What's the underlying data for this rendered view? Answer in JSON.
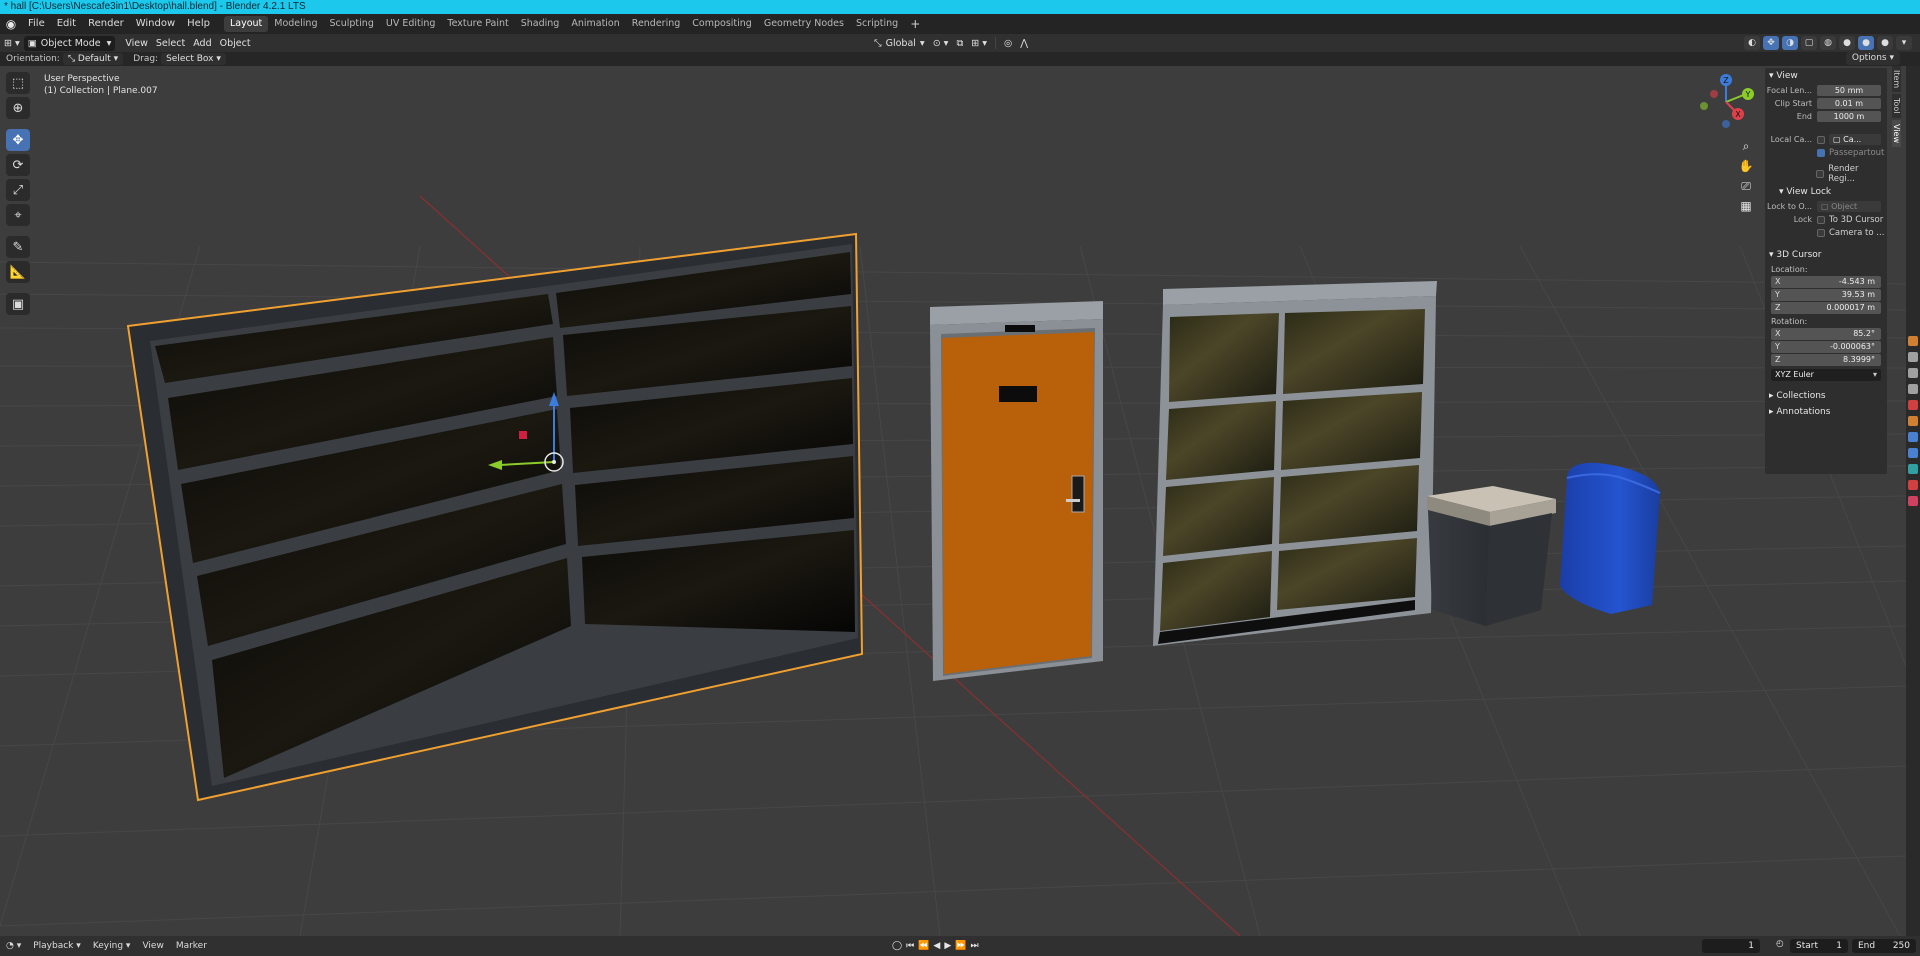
{
  "window": {
    "title": "* hall [C:\\Users\\Nescafe3in1\\Desktop\\hall.blend] - Blender 4.2.1 LTS"
  },
  "menubar": {
    "menus": [
      "File",
      "Edit",
      "Render",
      "Window",
      "Help"
    ],
    "workspaces": [
      "Layout",
      "Modeling",
      "Sculpting",
      "UV Editing",
      "Texture Paint",
      "Shading",
      "Animation",
      "Rendering",
      "Compositing",
      "Geometry Nodes",
      "Scripting"
    ],
    "active_workspace": "Layout",
    "add_label": "+"
  },
  "header": {
    "mode": "Object Mode",
    "menus": [
      "View",
      "Select",
      "Add",
      "Object"
    ],
    "transform_orientation": "Global"
  },
  "subheader": {
    "orientation_label": "Orientation:",
    "orientation_value": "Default",
    "drag_label": "Drag:",
    "drag_value": "Select Box",
    "options_label": "Options"
  },
  "viewport": {
    "view_name": "User Perspective",
    "collection_info": "(1) Collection | Plane.007"
  },
  "npanel": {
    "view_section": "View",
    "focal_label": "Focal Len...",
    "focal_value": "50 mm",
    "clip_start_label": "Clip Start",
    "clip_start_value": "0.01 m",
    "clip_end_label": "End",
    "clip_end_value": "1000 m",
    "local_camera_label": "Local Ca...",
    "local_camera_value": "Ca...",
    "passepartout_label": "Passepartout",
    "render_region_label": "Render Regi...",
    "view_lock_section": "View Lock",
    "lock_to_label": "Lock to O...",
    "lock_to_value": "Object",
    "lock_label": "Lock",
    "to_cursor_label": "To 3D Cursor",
    "camera_to_label": "Camera to ...",
    "cursor_section": "3D Cursor",
    "location_label": "Location:",
    "loc_x": "-4.543 m",
    "loc_y": "39.53 m",
    "loc_z": "0.000017 m",
    "rotation_label": "Rotation:",
    "rot_x": "85.2°",
    "rot_y": "-0.000063°",
    "rot_z": "8.3999°",
    "rotation_mode": "XYZ Euler",
    "collections_section": "Collections",
    "annotations_section": "Annotations"
  },
  "sidetabs": [
    "Item",
    "Tool",
    "View"
  ],
  "timeline": {
    "menus": [
      "Playback",
      "Keying",
      "View",
      "Marker"
    ],
    "current_frame": "1",
    "start_label": "Start",
    "start_value": "1",
    "end_label": "End",
    "end_value": "250"
  },
  "colors": {
    "title_bar": "#1cc8ec",
    "accent": "#4772b3",
    "selection_outline": "#f0a030",
    "door": "#b9600a",
    "mailbox": "#1f48b8",
    "axis_x": "#e0404a",
    "axis_y": "#8ccc2a",
    "axis_z": "#3c7cdc"
  },
  "axes": {
    "x": "X",
    "y": "Y",
    "z": "Z"
  }
}
